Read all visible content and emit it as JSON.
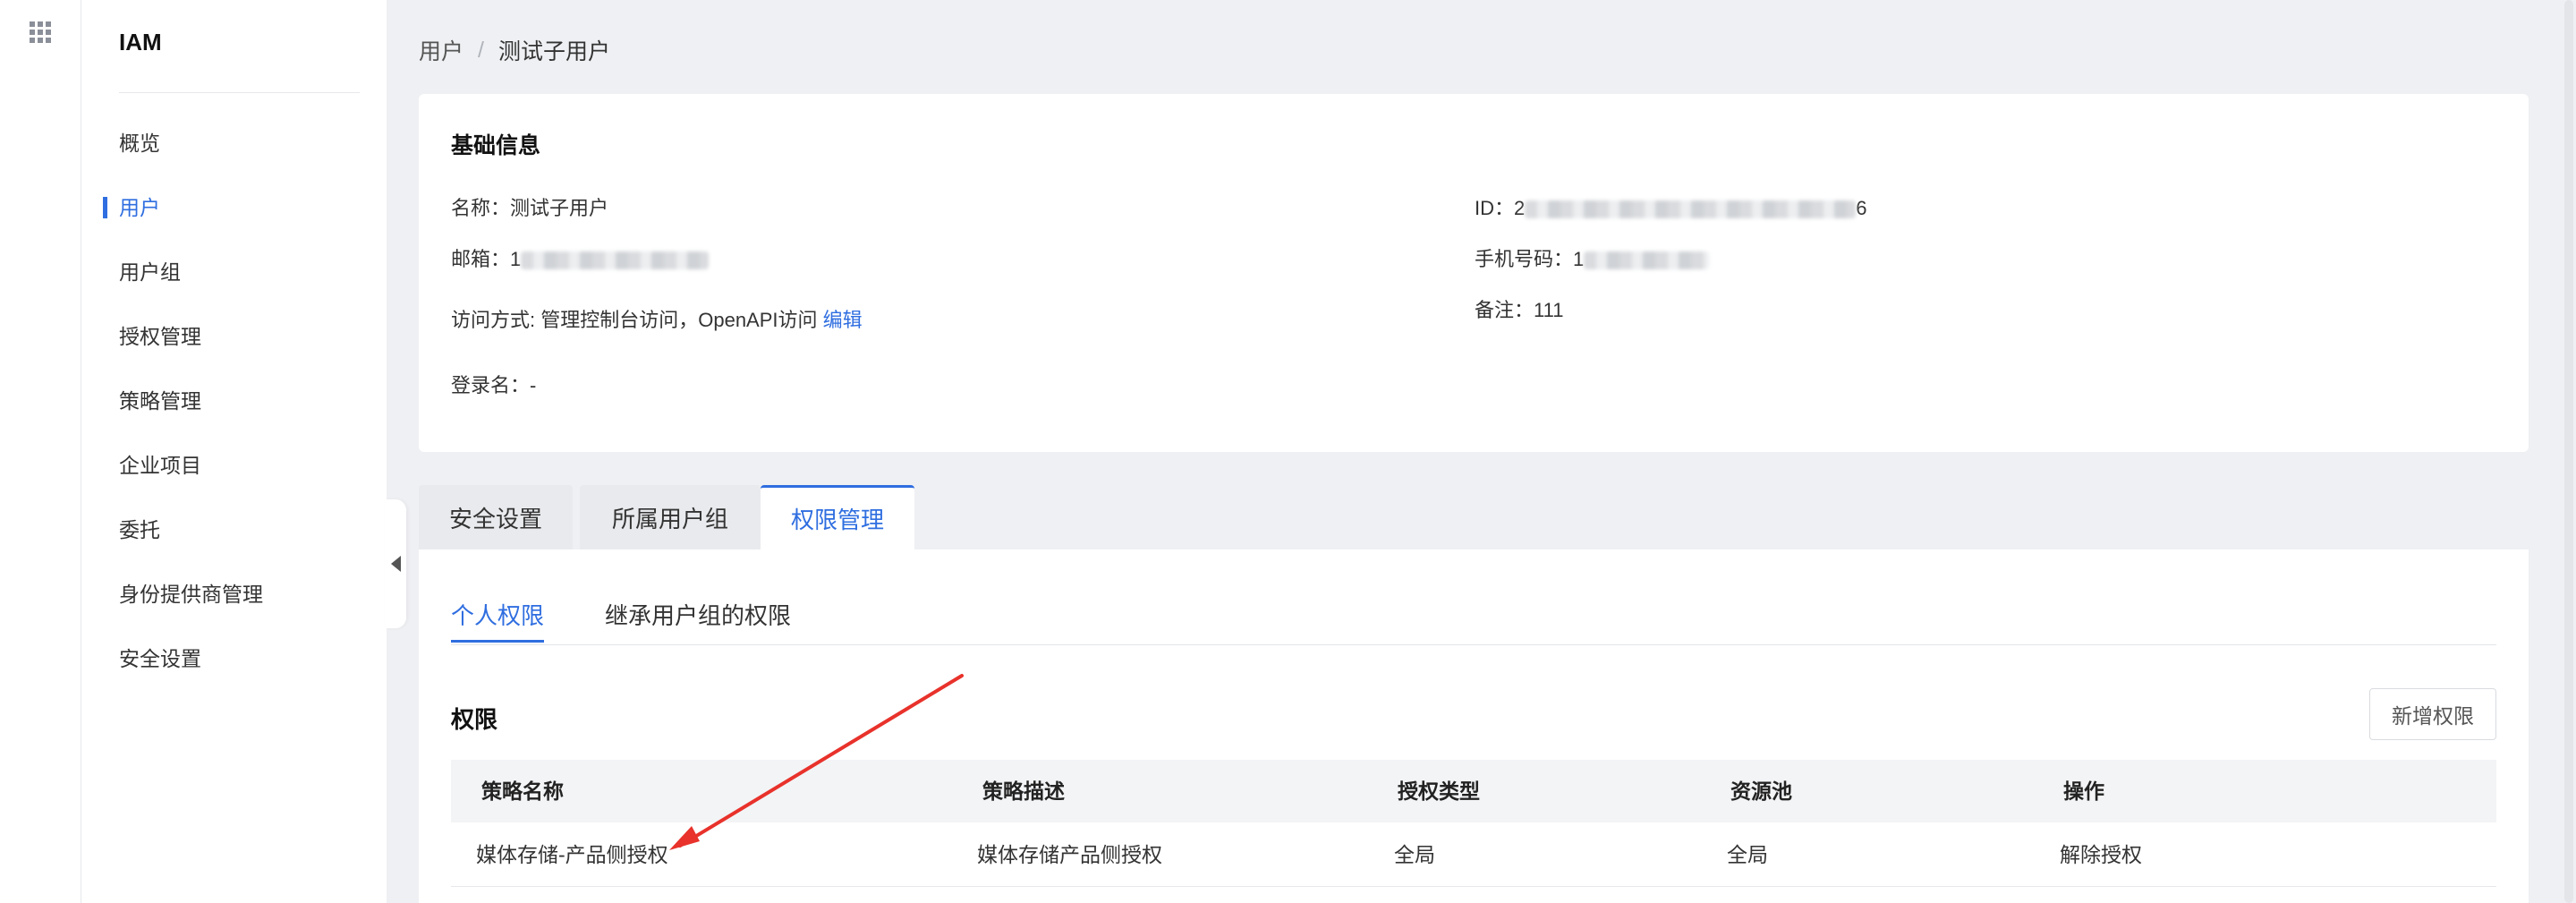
{
  "app": {
    "brand": "IAM",
    "icons": {
      "apps": "apps-grid-icon",
      "collapse": "caret-left-icon"
    },
    "accent_color": "#2f6ee0"
  },
  "sidebar": {
    "items": [
      {
        "label": "概览"
      },
      {
        "label": "用户"
      },
      {
        "label": "用户组"
      },
      {
        "label": "授权管理"
      },
      {
        "label": "策略管理"
      },
      {
        "label": "企业项目"
      },
      {
        "label": "委托"
      },
      {
        "label": "身份提供商管理"
      },
      {
        "label": "安全设置"
      }
    ],
    "active_index": 1
  },
  "breadcrumb": {
    "parent": "用户",
    "separator": "/",
    "current": "测试子用户"
  },
  "basic_info": {
    "title": "基础信息",
    "name_label": "名称：",
    "name_value": "测试子用户",
    "email_label": "邮箱：",
    "email_value_prefix": "1",
    "access_label": "访问方式: ",
    "access_value": "管理控制台访问，OpenAPI访问",
    "edit_link": "编辑",
    "login_label": "登录名：",
    "login_value": "-",
    "id_label": "ID：",
    "id_value_prefix": "2",
    "id_value_suffix": "6",
    "phone_label": "手机号码：",
    "phone_value_prefix": "1",
    "note_label": "备注：",
    "note_value": "111"
  },
  "tabs": [
    {
      "label": "安全设置"
    },
    {
      "label": "所属用户组"
    },
    {
      "label": "权限管理"
    }
  ],
  "active_tab": 2,
  "subtabs": [
    {
      "label": "个人权限"
    },
    {
      "label": "继承用户组的权限"
    }
  ],
  "active_subtab": 0,
  "permissions": {
    "title": "权限",
    "add_button": "新增权限",
    "columns": [
      "策略名称",
      "策略描述",
      "授权类型",
      "资源池",
      "操作"
    ],
    "rows": [
      {
        "policy_name": "媒体存储-产品侧授权",
        "policy_desc": "媒体存储产品侧授权",
        "grant_type": "全局",
        "resource_pool": "全局",
        "action": "解除授权"
      }
    ]
  },
  "annotation": {
    "color": "#e8322b"
  }
}
